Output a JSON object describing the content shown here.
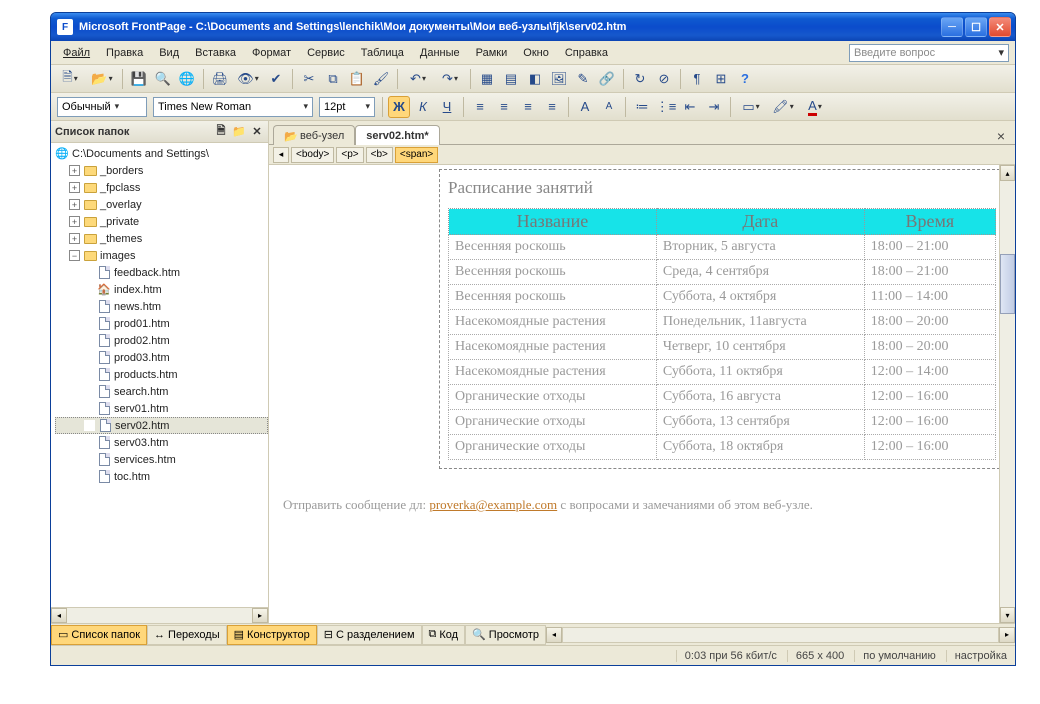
{
  "titlebar": {
    "app_icon_label": "F",
    "title": "Microsoft FrontPage - C:\\Documents and Settings\\lenchik\\Мои документы\\Мои веб-узлы\\fjk\\serv02.htm"
  },
  "menu": {
    "file": "Файл",
    "edit": "Правка",
    "view": "Вид",
    "insert": "Вставка",
    "format": "Формат",
    "tools": "Сервис",
    "table": "Таблица",
    "data": "Данные",
    "frames": "Рамки",
    "window": "Окно",
    "help": "Справка",
    "ask_placeholder": "Введите вопрос"
  },
  "format_bar": {
    "style": "Обычный",
    "font": "Times New Roman",
    "size": "12pt",
    "bold": "Ж",
    "italic": "К",
    "underline": "Ч"
  },
  "panel": {
    "title": "Список папок",
    "root": "C:\\Documents and Settings\\",
    "folders": [
      "_borders",
      "_fpclass",
      "_overlay",
      "_private",
      "_themes",
      "images"
    ],
    "files": [
      "feedback.htm",
      "index.htm",
      "news.htm",
      "prod01.htm",
      "prod02.htm",
      "prod03.htm",
      "products.htm",
      "search.htm",
      "serv01.htm",
      "serv02.htm",
      "serv03.htm",
      "services.htm",
      "toc.htm"
    ],
    "selected": "serv02.htm"
  },
  "tabs": {
    "site": "веб-узел",
    "doc": "serv02.htm*"
  },
  "breadcrumbs": [
    "<body>",
    "<p>",
    "<b>",
    "<span>"
  ],
  "doc": {
    "heading": "Расписание занятий",
    "cols": {
      "name": "Название",
      "date": "Дата",
      "time": "Время"
    },
    "rows": [
      {
        "name": "Весенняя роскошь",
        "date": "Вторник, 5 августа",
        "time": "18:00 – 21:00"
      },
      {
        "name": "Весенняя роскошь",
        "date": "Среда, 4 сентября",
        "time": "18:00 – 21:00"
      },
      {
        "name": "Весенняя роскошь",
        "date": "Суббота, 4 октября",
        "time": "11:00 – 14:00"
      },
      {
        "name": "Насекомоядные растения",
        "date": "Понедельник, 11августа",
        "time": "18:00 – 20:00"
      },
      {
        "name": "Насекомоядные растения",
        "date": "Четверг, 10 сентября",
        "time": "18:00 – 20:00"
      },
      {
        "name": "Насекомоядные растения",
        "date": "Суббота, 11 октября",
        "time": "12:00 – 14:00"
      },
      {
        "name": "Органические отходы",
        "date": "Суббота, 16 августа",
        "time": "12:00 – 16:00"
      },
      {
        "name": "Органические отходы",
        "date": "Суббота, 13 сентября",
        "time": "12:00 – 16:00"
      },
      {
        "name": "Органические отходы",
        "date": "Суббота, 18 октября",
        "time": "12:00 – 16:00"
      }
    ],
    "footer_pre": "Отправить сообщение дл: ",
    "footer_link": "proverka@example.com",
    "footer_post": " с вопросами и замечаниями об этом веб-узле."
  },
  "viewtabs": {
    "folders": "Список папок",
    "transitions": "Переходы",
    "design": "Конструктор",
    "split": "С разделением",
    "code": "Код",
    "preview": "Просмотр"
  },
  "status": {
    "speed": "0:03 при 56 кбит/с",
    "size": "665 x 400",
    "mode": "по умолчанию",
    "settings": "настройка"
  }
}
